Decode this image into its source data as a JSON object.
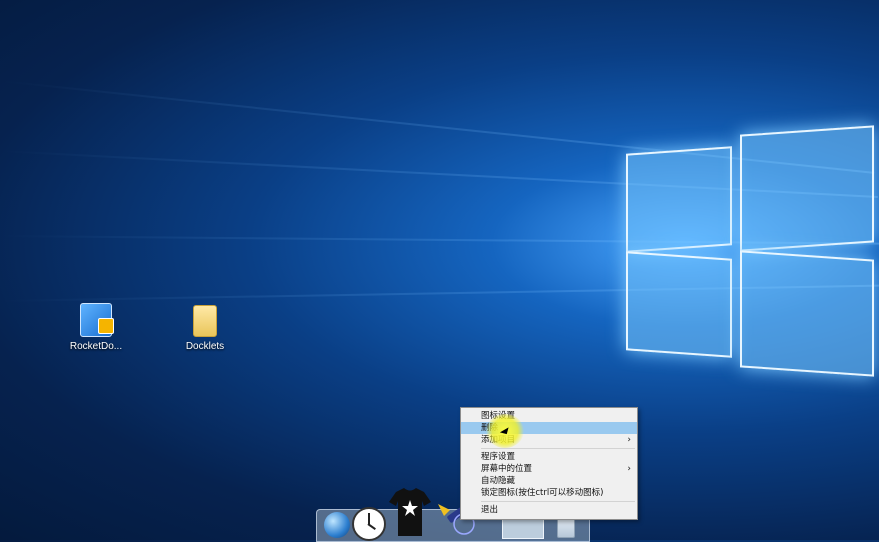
{
  "desktop": {
    "icons": [
      {
        "label": "RocketDo...",
        "icon": "rocketdock-icon"
      },
      {
        "label": "Docklets",
        "icon": "folder-icon"
      }
    ]
  },
  "dock": {
    "items": [
      "globe-icon",
      "clock-icon",
      "tshirt-icon",
      "wand-icon",
      "blank-tile-icon",
      "recycle-bin-icon"
    ]
  },
  "context_menu": {
    "items": [
      {
        "label": "图标设置",
        "highlighted": false,
        "submenu": false
      },
      {
        "label": "删除",
        "highlighted": true,
        "submenu": false
      },
      {
        "label": "添加项目",
        "highlighted": false,
        "submenu": true
      },
      {
        "label": "程序设置",
        "highlighted": false,
        "submenu": false
      },
      {
        "label": "屏幕中的位置",
        "highlighted": false,
        "submenu": true
      },
      {
        "label": "自动隐藏",
        "highlighted": false,
        "submenu": false
      },
      {
        "label": "锁定图标(按住ctrl可以移动图标)",
        "highlighted": false,
        "submenu": false
      },
      {
        "label": "退出",
        "highlighted": false,
        "submenu": false
      }
    ],
    "highlight_color": "#99c9ef",
    "submenu_arrow": "›"
  }
}
